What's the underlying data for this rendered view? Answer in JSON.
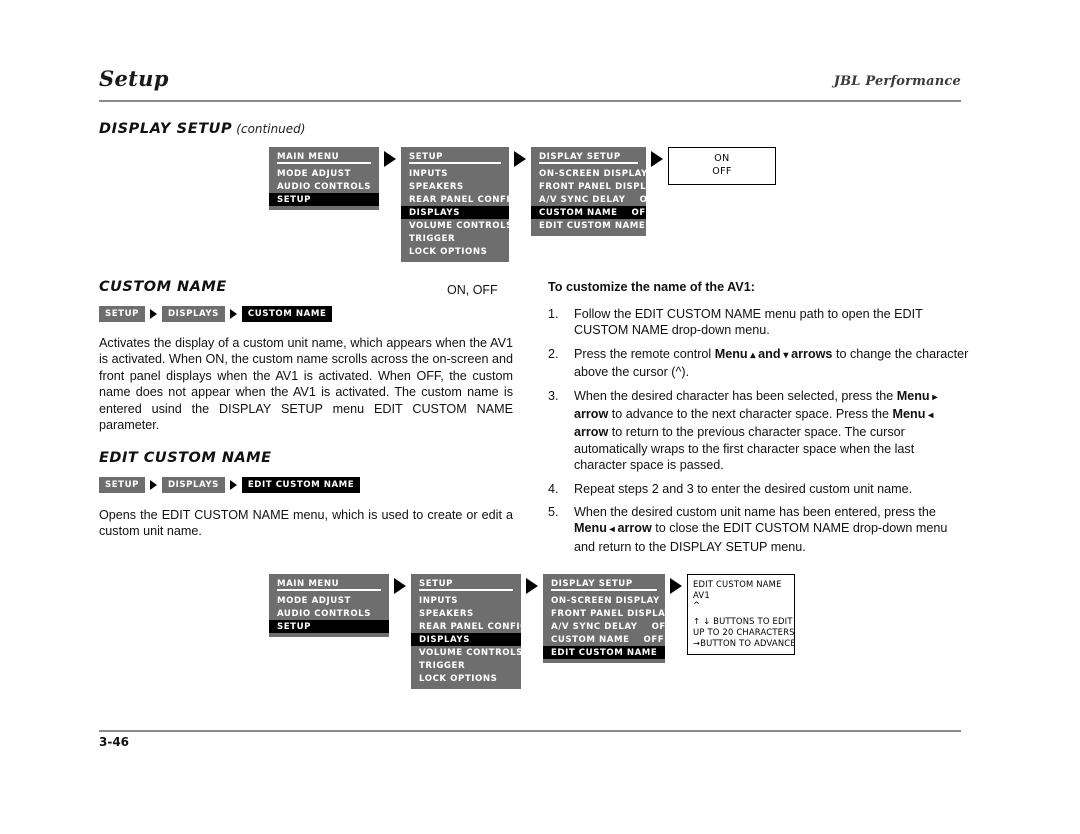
{
  "header": {
    "chapter_title": "Setup",
    "brand": "JBL Performance"
  },
  "section": {
    "title": "DISPLAY SETUP",
    "continued": "(continued)"
  },
  "top_flow": {
    "panels": [
      {
        "title": "MAIN MENU",
        "rows": [
          {
            "label": "MODE ADJUST",
            "value": "",
            "selected": false
          },
          {
            "label": "AUDIO CONTROLS",
            "value": "",
            "selected": false
          },
          {
            "label": "SETUP",
            "value": "",
            "selected": true
          }
        ]
      },
      {
        "title": "SETUP",
        "rows": [
          {
            "label": "INPUTS",
            "value": "",
            "selected": false
          },
          {
            "label": "SPEAKERS",
            "value": "",
            "selected": false
          },
          {
            "label": "REAR PANEL CONFIG",
            "value": "",
            "selected": false
          },
          {
            "label": "DISPLAYS",
            "value": "",
            "selected": true
          },
          {
            "label": "VOLUME CONTROLS",
            "value": "",
            "selected": false
          },
          {
            "label": "TRIGGER",
            "value": "",
            "selected": false
          },
          {
            "label": "LOCK OPTIONS",
            "value": "",
            "selected": false
          }
        ]
      },
      {
        "title": "DISPLAY SETUP",
        "rows": [
          {
            "label": "ON-SCREEN DISPLAY",
            "value": "",
            "selected": false
          },
          {
            "label": "FRONT PANEL DISPLAY",
            "value": "",
            "selected": false
          },
          {
            "label": "A/V SYNC DELAY",
            "value": "OFF",
            "selected": false
          },
          {
            "label": "CUSTOM NAME",
            "value": "OFF",
            "selected": true
          },
          {
            "label": "EDIT CUSTOM NAME",
            "value": "",
            "selected": false
          }
        ]
      }
    ],
    "popup": {
      "line1": "ON",
      "line2": "OFF"
    }
  },
  "bottom_flow": {
    "panels": [
      {
        "title": "MAIN MENU",
        "rows": [
          {
            "label": "MODE ADJUST",
            "value": "",
            "selected": false
          },
          {
            "label": "AUDIO CONTROLS",
            "value": "",
            "selected": false
          },
          {
            "label": "SETUP",
            "value": "",
            "selected": true
          }
        ]
      },
      {
        "title": "SETUP",
        "rows": [
          {
            "label": "INPUTS",
            "value": "",
            "selected": false
          },
          {
            "label": "SPEAKERS",
            "value": "",
            "selected": false
          },
          {
            "label": "REAR PANEL CONFIG",
            "value": "",
            "selected": false
          },
          {
            "label": "DISPLAYS",
            "value": "",
            "selected": true
          },
          {
            "label": "VOLUME CONTROLS",
            "value": "",
            "selected": false
          },
          {
            "label": "TRIGGER",
            "value": "",
            "selected": false
          },
          {
            "label": "LOCK OPTIONS",
            "value": "",
            "selected": false
          }
        ]
      },
      {
        "title": "DISPLAY SETUP",
        "rows": [
          {
            "label": "ON-SCREEN DISPLAY",
            "value": "",
            "selected": false
          },
          {
            "label": "FRONT PANEL DISPLAY",
            "value": "",
            "selected": false
          },
          {
            "label": "A/V SYNC DELAY",
            "value": "OFF",
            "selected": false
          },
          {
            "label": "CUSTOM NAME",
            "value": "OFF",
            "selected": false
          },
          {
            "label": "EDIT CUSTOM NAME",
            "value": "",
            "selected": true
          }
        ]
      }
    ],
    "popup": {
      "title": "EDIT CUSTOM NAME",
      "name_value": "AV1",
      "cursor": "^",
      "hint1": "↑ ↓ BUTTONS TO EDIT",
      "hint2": "UP TO 20 CHARACTERS",
      "hint3": "→BUTTON TO ADVANCE"
    }
  },
  "custom_name": {
    "title": "CUSTOM NAME",
    "values": "ON, OFF",
    "breadcrumb": [
      "SETUP",
      "DISPLAYS",
      "CUSTOM NAME"
    ],
    "body": "Activates the display of a custom unit name, which appears when the AV1 is activated. When ON, the custom name scrolls across the on-screen and front panel displays when the AV1 is activated. When OFF, the custom name does not appear when the AV1 is activated. The custom name is entered usind the DISPLAY SETUP menu EDIT CUSTOM NAME parameter."
  },
  "edit_custom_name": {
    "title": "EDIT CUSTOM NAME",
    "breadcrumb": [
      "SETUP",
      "DISPLAYS",
      "EDIT CUSTOM NAME"
    ],
    "body": "Opens the EDIT CUSTOM NAME menu, which is used to create or edit a custom unit name."
  },
  "instructions": {
    "heading": "To customize the name of the AV1:",
    "items": [
      {
        "num": "1.",
        "parts": [
          {
            "t": "Follow the EDIT CUSTOM NAME menu path to open the EDIT CUSTOM NAME drop-down menu.",
            "b": false
          }
        ]
      },
      {
        "num": "2.",
        "parts": [
          {
            "t": "Press the remote control ",
            "b": false
          },
          {
            "t": "Menu",
            "b": true
          },
          {
            "t": " ▴ ",
            "b": true
          },
          {
            "t": "and",
            "b": true
          },
          {
            "t": " ▾ ",
            "b": true
          },
          {
            "t": "arrows",
            "b": true
          },
          {
            "t": " to change the character above the cursor (^).",
            "b": false
          }
        ]
      },
      {
        "num": "3.",
        "parts": [
          {
            "t": "When the desired character has been selected, press the ",
            "b": false
          },
          {
            "t": "Menu",
            "b": true
          },
          {
            "t": " ▸ ",
            "b": true
          },
          {
            "t": "arrow",
            "b": true
          },
          {
            "t": " to advance to the next character space. Press the ",
            "b": false
          },
          {
            "t": "Menu",
            "b": true
          },
          {
            "t": " ◂ ",
            "b": true
          },
          {
            "t": "arrow",
            "b": true
          },
          {
            "t": " to return to the previous character space. The cursor automatically wraps to the first character space when the last character space is passed.",
            "b": false
          }
        ]
      },
      {
        "num": "4.",
        "parts": [
          {
            "t": "Repeat steps 2 and 3 to enter the desired custom unit name.",
            "b": false
          }
        ]
      },
      {
        "num": "5.",
        "parts": [
          {
            "t": "When the desired custom unit name has been entered, press the ",
            "b": false
          },
          {
            "t": "Menu",
            "b": true
          },
          {
            "t": " ◂ ",
            "b": true
          },
          {
            "t": "arrow",
            "b": true
          },
          {
            "t": " to close the EDIT CUSTOM NAME drop-down menu and return to the DISPLAY SETUP menu.",
            "b": false
          }
        ]
      }
    ]
  },
  "footer": {
    "page_number": "3-46"
  }
}
